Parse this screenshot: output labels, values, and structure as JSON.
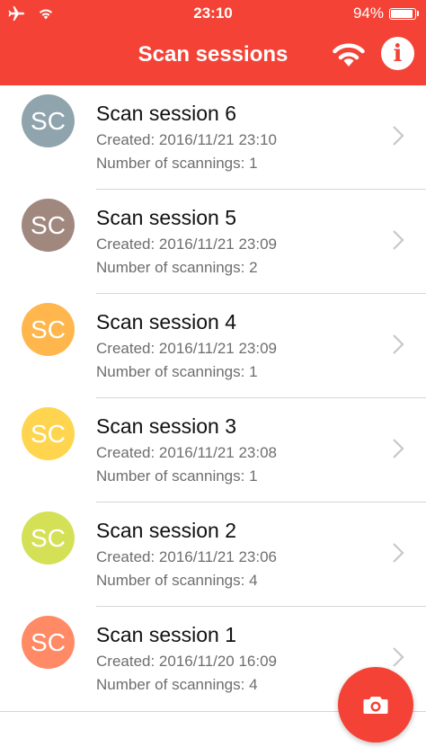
{
  "status_bar": {
    "time": "23:10",
    "battery_text": "94%",
    "battery_level": 0.94,
    "icons": [
      "airplane-icon",
      "wifi-icon",
      "battery-icon"
    ]
  },
  "nav": {
    "title": "Scan sessions",
    "wifi_icon": "wifi-icon",
    "info_label": "i"
  },
  "colors": {
    "accent": "#f44336",
    "avatar_1": "#90a4ae",
    "avatar_2": "#a1887f",
    "avatar_3": "#ffb74d",
    "avatar_4": "#ffd54f",
    "avatar_5": "#d4e157",
    "avatar_6": "#ff8a65"
  },
  "sessions": [
    {
      "initials": "SC",
      "title": "Scan session 6",
      "created": "Created: 2016/11/21 23:10",
      "count": "Number of scannings: 1"
    },
    {
      "initials": "SC",
      "title": "Scan session 5",
      "created": "Created: 2016/11/21 23:09",
      "count": "Number of scannings: 2"
    },
    {
      "initials": "SC",
      "title": "Scan session 4",
      "created": "Created: 2016/11/21 23:09",
      "count": "Number of scannings: 1"
    },
    {
      "initials": "SC",
      "title": "Scan session 3",
      "created": "Created: 2016/11/21 23:08",
      "count": "Number of scannings: 1"
    },
    {
      "initials": "SC",
      "title": "Scan session 2",
      "created": "Created: 2016/11/21 23:06",
      "count": "Number of scannings: 4"
    },
    {
      "initials": "SC",
      "title": "Scan session 1",
      "created": "Created: 2016/11/20 16:09",
      "count": "Number of scannings: 4"
    }
  ],
  "fab": {
    "icon": "camera-icon"
  }
}
